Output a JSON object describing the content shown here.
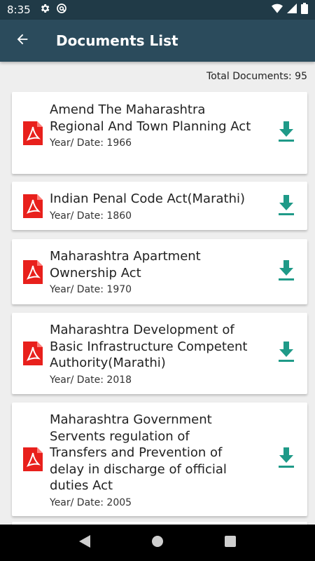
{
  "status_bar": {
    "time": "8:35"
  },
  "app_bar": {
    "title": "Documents List"
  },
  "total_label": "Total Documents: 95",
  "documents": [
    {
      "title": "Amend The Maharashtra Regional And Town Planning Act",
      "year": "Year/ Date: 1966"
    },
    {
      "title": "Indian Penal Code Act(Marathi)",
      "year": "Year/ Date: 1860"
    },
    {
      "title": "Maharashtra Apartment Ownership Act",
      "year": "Year/ Date: 1970"
    },
    {
      "title": "Maharashtra Development of Basic Infrastructure Competent Authority(Marathi)",
      "year": "Year/ Date: 2018"
    },
    {
      "title": "Maharashtra Government Servents regulation of Transfers and Prevention of delay in discharge of official duties Act",
      "year": "Year/ Date: 2005"
    }
  ],
  "icons": {
    "document": "pdf-file-icon",
    "action": "download-icon",
    "back": "arrow-back-icon"
  },
  "colors": {
    "app_bar": "#2b4b5c",
    "status_bar": "#203a47",
    "accent": "#1f9a88",
    "pdf_red": "#e8201c"
  }
}
